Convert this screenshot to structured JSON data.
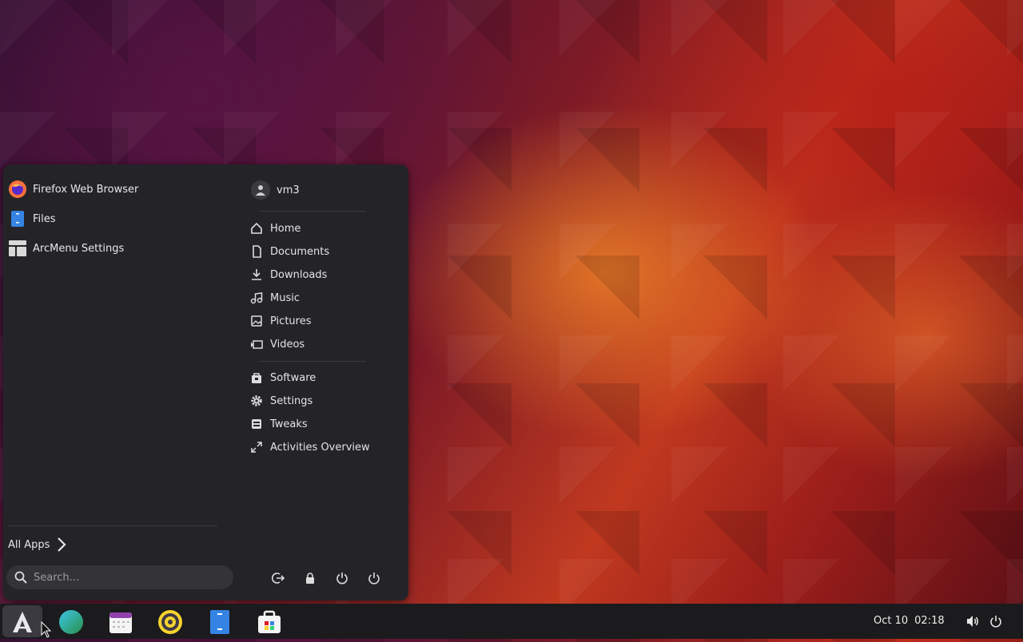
{
  "menu": {
    "apps": [
      {
        "label": "Firefox Web Browser",
        "icon": "firefox-icon"
      },
      {
        "label": "Files",
        "icon": "files-icon"
      },
      {
        "label": "ArcMenu Settings",
        "icon": "arcmenu-settings-icon"
      }
    ],
    "user": {
      "name": "vm3",
      "icon": "user-icon"
    },
    "places": [
      {
        "label": "Home",
        "icon": "home-icon"
      },
      {
        "label": "Documents",
        "icon": "document-icon"
      },
      {
        "label": "Downloads",
        "icon": "download-icon"
      },
      {
        "label": "Music",
        "icon": "music-icon"
      },
      {
        "label": "Pictures",
        "icon": "picture-icon"
      },
      {
        "label": "Videos",
        "icon": "video-icon"
      }
    ],
    "system": [
      {
        "label": "Software",
        "icon": "software-icon"
      },
      {
        "label": "Settings",
        "icon": "gear-icon"
      },
      {
        "label": "Tweaks",
        "icon": "tweaks-icon"
      },
      {
        "label": "Activities Overview",
        "icon": "activities-icon"
      }
    ],
    "all_apps_label": "All Apps",
    "search_placeholder": "Search…",
    "power_buttons": [
      "logout-icon",
      "lock-icon",
      "restart-icon",
      "power-icon"
    ]
  },
  "taskbar": {
    "date": "Oct 10",
    "time": "02:18",
    "apps": [
      "arcmenu-icon",
      "browser-icon",
      "calendar-icon",
      "music-player-icon",
      "files-icon",
      "software-store-icon"
    ]
  },
  "colors": {
    "menu_bg": "#242428",
    "taskbar_bg": "#1b1b1d",
    "accent": "#3584e4"
  }
}
